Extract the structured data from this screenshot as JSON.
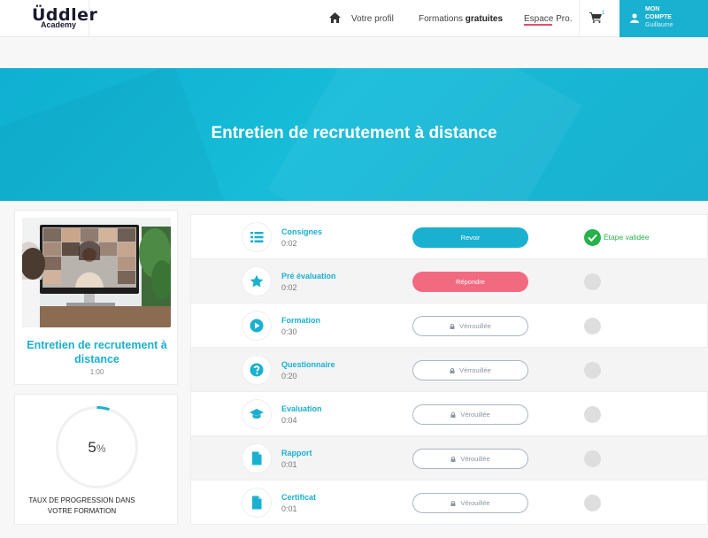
{
  "header": {
    "logo_main": "Üddler",
    "logo_sub": "Academy",
    "nav": {
      "profil": "Votre profil",
      "formations_prefix": "Formations ",
      "formations_bold": "gratuites",
      "espace": "Espace Pro."
    },
    "cart_count": "1",
    "account": {
      "line1": "MON",
      "line2": "COMPTE",
      "line3": "Guillaume"
    }
  },
  "banner": {
    "title": "Entretien de recrutement à distance"
  },
  "course": {
    "title": "Entretien de recrutement à distance",
    "duration": "1:00"
  },
  "progress": {
    "value": "5",
    "unit": "%",
    "fraction": 0.05,
    "label_line1": "TAUX DE PROGRESSION DANS",
    "label_line2": "VOTRE FORMATION"
  },
  "steps": [
    {
      "name": "Consignes",
      "time": "0:02",
      "icon": "list-icon",
      "button": "Revoir",
      "state": "done",
      "status_text": "Étape validée"
    },
    {
      "name": "Pré évaluation",
      "time": "0:02",
      "icon": "star-icon",
      "button": "Répondre",
      "state": "active"
    },
    {
      "name": "Formation",
      "time": "0:30",
      "icon": "play-icon",
      "button": "Vérrouillée",
      "state": "locked"
    },
    {
      "name": "Questionnaire",
      "time": "0:20",
      "icon": "question-icon",
      "button": "Vérrouillée",
      "state": "locked"
    },
    {
      "name": "Evaluation",
      "time": "0:04",
      "icon": "graduation-cap-icon",
      "button": "Vérouillée",
      "state": "locked"
    },
    {
      "name": "Rapport",
      "time": "0:01",
      "icon": "document-icon",
      "button": "Vérouillée",
      "state": "locked"
    },
    {
      "name": "Certificat",
      "time": "0:01",
      "icon": "document-icon",
      "button": "Vérouillée",
      "state": "locked"
    }
  ],
  "colors": {
    "accent": "#1ab0cf",
    "pink": "#f26a80",
    "success": "#27b14a"
  }
}
